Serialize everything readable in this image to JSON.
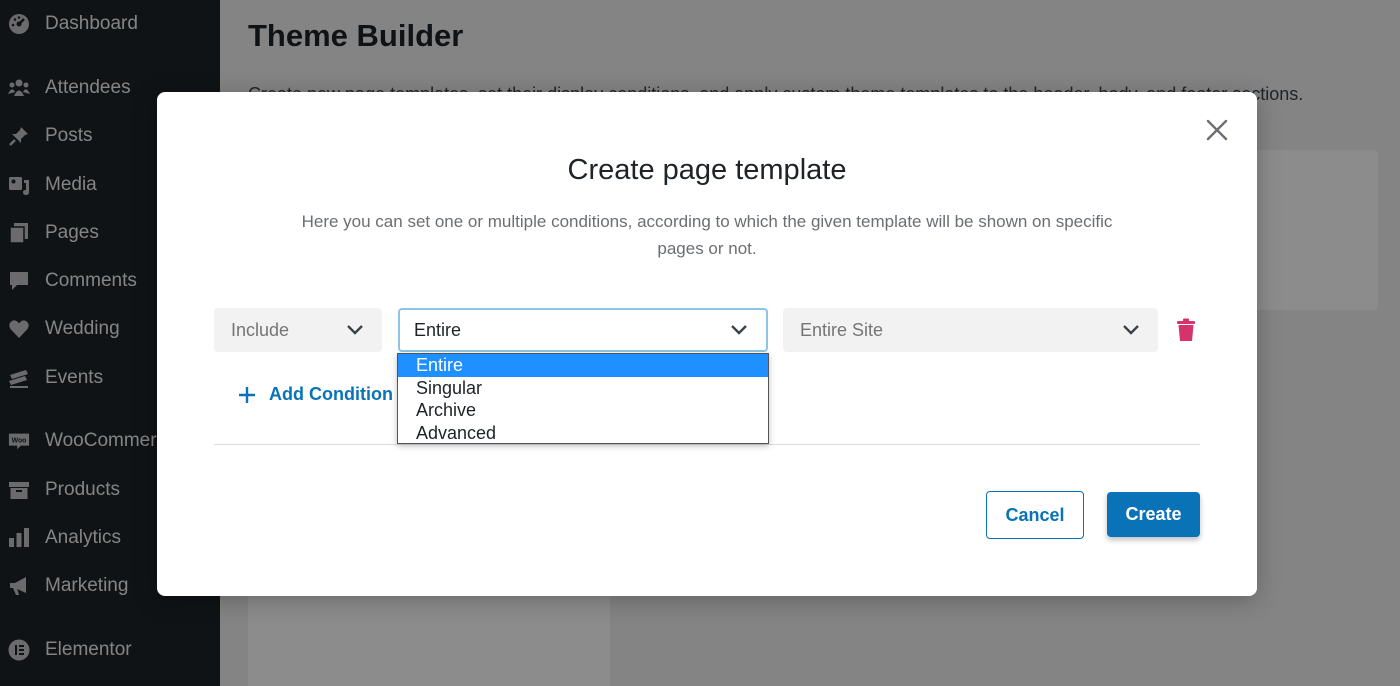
{
  "sidebar": {
    "items": [
      {
        "label": "Dashboard",
        "icon": "dashboard-icon"
      },
      {
        "label": "Attendees",
        "icon": "groups-icon"
      },
      {
        "label": "Posts",
        "icon": "pin-icon"
      },
      {
        "label": "Media",
        "icon": "media-icon"
      },
      {
        "label": "Pages",
        "icon": "pages-icon"
      },
      {
        "label": "Comments",
        "icon": "comment-icon"
      },
      {
        "label": "Wedding",
        "icon": "heart-icon"
      },
      {
        "label": "Events",
        "icon": "events-icon"
      },
      {
        "label": "WooCommerce",
        "icon": "woo-icon",
        "badge": "Woo"
      },
      {
        "label": "Products",
        "icon": "archive-icon"
      },
      {
        "label": "Analytics",
        "icon": "chart-bar-icon"
      },
      {
        "label": "Marketing",
        "icon": "megaphone-icon"
      },
      {
        "label": "Elementor",
        "icon": "elementor-icon"
      }
    ]
  },
  "page": {
    "title": "Theme Builder",
    "description": "Create new page templates, set their display conditions, and apply custom theme templates to the header, body, and footer sections."
  },
  "modal": {
    "title": "Create page template",
    "description": "Here you can set one or multiple conditions, according to which the given template will be shown on specific pages or not.",
    "condition": {
      "include_value": "Include",
      "type_value": "Entire",
      "site_value": "Entire Site"
    },
    "dropdown": {
      "options": [
        "Entire",
        "Singular",
        "Archive",
        "Advanced"
      ],
      "selected_index": 0
    },
    "add_condition_label": "Add Condition",
    "cancel_label": "Cancel",
    "create_label": "Create"
  },
  "colors": {
    "accent": "#0a73b7",
    "highlight": "#1e90ff",
    "delete": "#d6336c",
    "sidebar_bg": "#1d2327"
  }
}
